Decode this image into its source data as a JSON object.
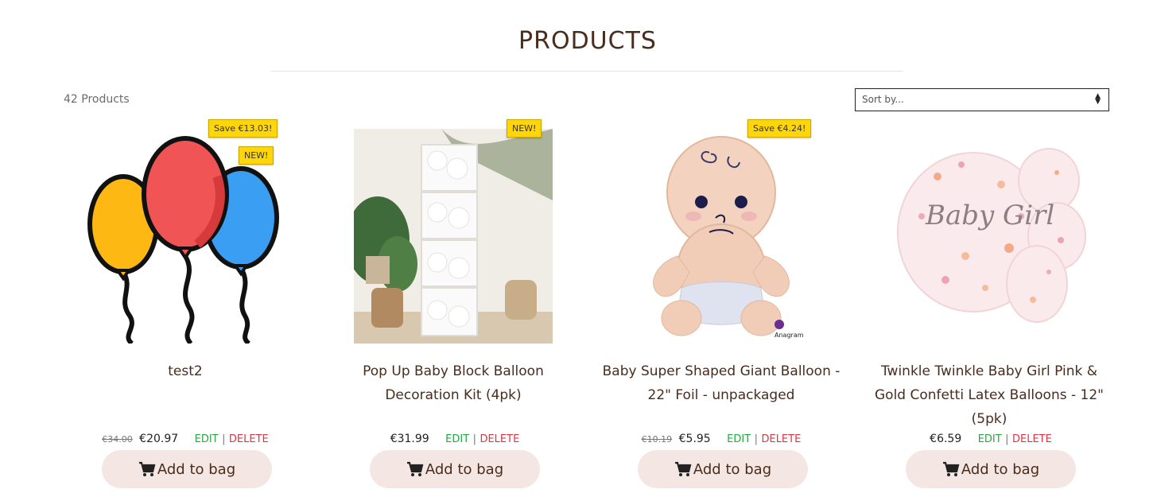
{
  "header": {
    "title": "PRODUCTS",
    "count": "42 Products",
    "sort_placeholder": "Sort by..."
  },
  "products": [
    {
      "name": "test2",
      "old_price": "€34.00",
      "price": "€20.97",
      "badges": [
        "Save €13.03!",
        "NEW!"
      ],
      "edit": "EDIT",
      "separator": "|",
      "delete": "DELETE",
      "bag": "Add to bag",
      "image": "balloons-illustration"
    },
    {
      "name": "Pop Up Baby Block Balloon Decoration Kit (4pk)",
      "old_price": "",
      "price": "€31.99",
      "badges": [
        "NEW!"
      ],
      "edit": "EDIT",
      "separator": "|",
      "delete": "DELETE",
      "bag": "Add to bag",
      "image": "baby-block-boxes-photo"
    },
    {
      "name": "Baby Super Shaped Giant Balloon - 22\" Foil - unpackaged",
      "old_price": "€10.19",
      "price": "€5.95",
      "badges": [
        "Save €4.24!"
      ],
      "edit": "EDIT",
      "separator": "|",
      "delete": "DELETE",
      "bag": "Add to bag",
      "image": "baby-foil-balloon",
      "brand": "Anagram"
    },
    {
      "name": "Twinkle Twinkle Baby Girl Pink & Gold Confetti Latex Balloons - 12\" (5pk)",
      "old_price": "",
      "price": "€6.59",
      "badges": [],
      "edit": "EDIT",
      "separator": "|",
      "delete": "DELETE",
      "bag": "Add to bag",
      "image": "confetti-balloons",
      "balloon_text": "Baby Girl"
    }
  ],
  "colors": {
    "text": "#4a2c1d",
    "badge": "#ffd60a",
    "button_bg": "#f4e6e3",
    "edit": "#28a745",
    "delete": "#dc3545"
  }
}
